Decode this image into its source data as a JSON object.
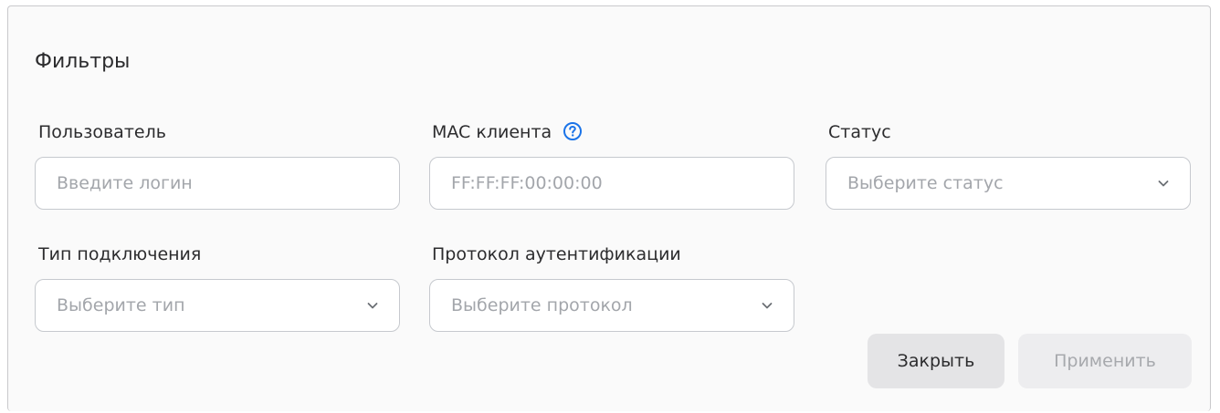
{
  "filters": {
    "title": "Фильтры",
    "user": {
      "label": "Пользователь",
      "placeholder": "Введите логин"
    },
    "mac": {
      "label": "MAC клиента",
      "placeholder": "FF:FF:FF:00:00:00",
      "help_icon": "question-circle-icon"
    },
    "status": {
      "label": "Статус",
      "placeholder": "Выберите статус"
    },
    "connection_type": {
      "label": "Тип подключения",
      "placeholder": "Выберите тип"
    },
    "auth_protocol": {
      "label": "Протокол аутентификации",
      "placeholder": "Выберите протокол"
    },
    "buttons": {
      "close": "Закрыть",
      "apply": "Применить"
    }
  },
  "colors": {
    "accent": "#1a73e8",
    "border": "#c6c9ce",
    "placeholder": "#a3a6ab",
    "text": "#2c2c2e"
  }
}
